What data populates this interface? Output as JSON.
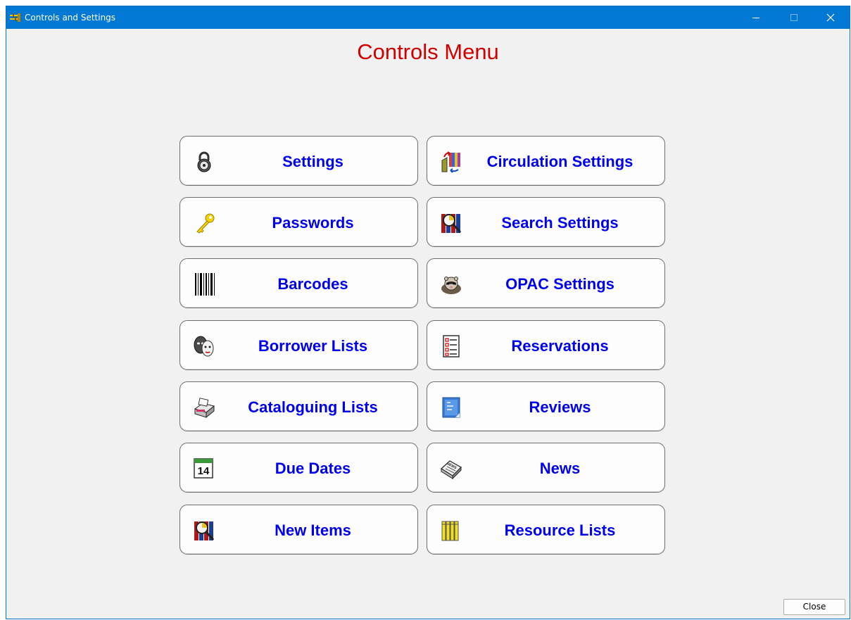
{
  "window": {
    "title": "Controls and Settings"
  },
  "main": {
    "heading": "Controls Menu",
    "left_buttons": [
      {
        "label": "Settings",
        "icon": "padlock-icon"
      },
      {
        "label": "Passwords",
        "icon": "key-icon"
      },
      {
        "label": "Barcodes",
        "icon": "barcode-icon"
      },
      {
        "label": "Borrower Lists",
        "icon": "masks-icon"
      },
      {
        "label": "Cataloguing Lists",
        "icon": "card-catalog-icon"
      },
      {
        "label": "Due Dates",
        "icon": "calendar-icon"
      },
      {
        "label": "New Items",
        "icon": "books-magnifier-icon"
      }
    ],
    "right_buttons": [
      {
        "label": "Circulation Settings",
        "icon": "books-arrows-icon"
      },
      {
        "label": "Search Settings",
        "icon": "books-magnifier-icon"
      },
      {
        "label": "OPAC Settings",
        "icon": "ferret-icon"
      },
      {
        "label": "Reservations",
        "icon": "checklist-icon"
      },
      {
        "label": "Reviews",
        "icon": "review-page-icon"
      },
      {
        "label": "News",
        "icon": "newspaper-icon"
      },
      {
        "label": "Resource Lists",
        "icon": "folders-icon"
      }
    ]
  },
  "footer": {
    "close_label": "Close"
  },
  "icons_text": {
    "calendar_day": "14",
    "news_word": "NEWS"
  },
  "colors": {
    "titlebar": "#0078d4",
    "heading": "#d00000",
    "button_text": "#0000ee"
  }
}
